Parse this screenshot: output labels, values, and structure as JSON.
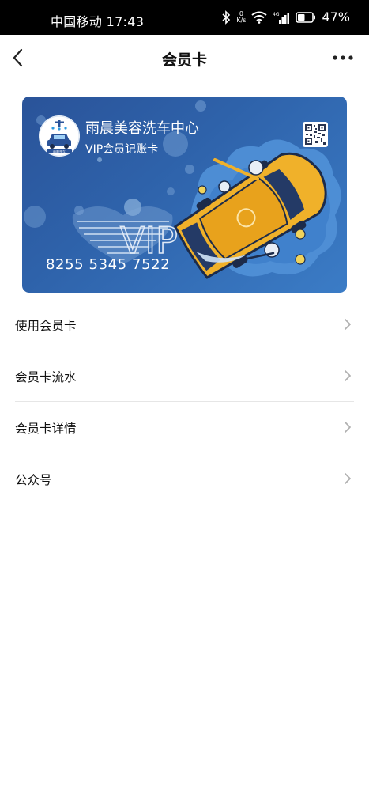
{
  "status_bar": {
    "carrier_time": "中国移动 17:43",
    "net_speed_value": "0",
    "net_speed_unit": "K/s",
    "signal_label": "4G",
    "battery_percent": "47%"
  },
  "header": {
    "title": "会员卡"
  },
  "card": {
    "shop_name": "雨晨美容洗车中心",
    "card_type": "VIP会员记账卡",
    "card_number": "8255 5345 7522",
    "vip_watermark": "VIP",
    "logo_caption": "雨晨洗车"
  },
  "menu": {
    "items": [
      {
        "label": "使用会员卡"
      },
      {
        "label": "会员卡流水"
      },
      {
        "label": "会员卡详情"
      },
      {
        "label": "公众号"
      }
    ]
  },
  "colors": {
    "card_blue": "#2e62aa",
    "car_yellow": "#f0b12a",
    "chevron_gray": "#b0b0b0"
  }
}
